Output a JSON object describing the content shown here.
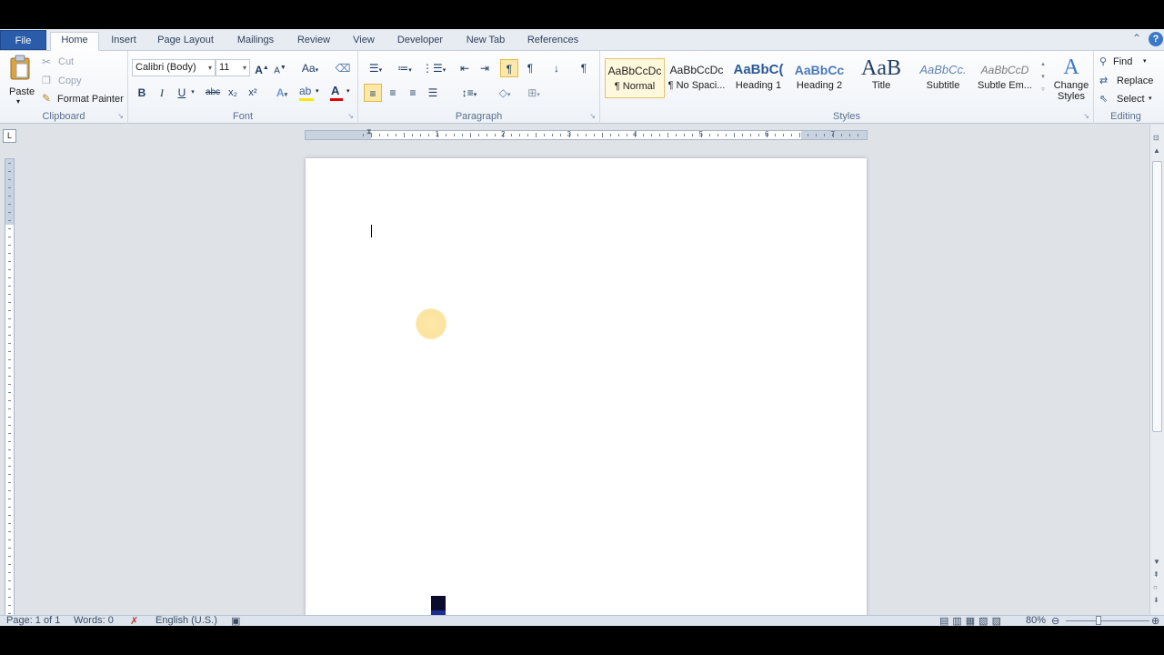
{
  "tabs": {
    "file": "File",
    "home": "Home",
    "insert": "Insert",
    "page_layout": "Page Layout",
    "mailings": "Mailings",
    "review": "Review",
    "view": "View",
    "developer": "Developer",
    "new_tab": "New Tab",
    "references": "References"
  },
  "clipboard": {
    "label": "Clipboard",
    "paste": "Paste",
    "cut": "Cut",
    "copy": "Copy",
    "format_painter": "Format Painter"
  },
  "font": {
    "label": "Font",
    "family": "Calibri (Body)",
    "size": "11",
    "bold": "B",
    "italic": "I",
    "underline": "U",
    "strike": "abc",
    "subscript": "x₂",
    "superscript": "x²"
  },
  "paragraph": {
    "label": "Paragraph"
  },
  "styles": {
    "label": "Styles",
    "items": [
      {
        "preview": "AaBbCcDc",
        "name": "¶ Normal"
      },
      {
        "preview": "AaBbCcDc",
        "name": "¶ No Spaci..."
      },
      {
        "preview": "AaBbC(",
        "name": "Heading 1"
      },
      {
        "preview": "AaBbCc",
        "name": "Heading 2"
      },
      {
        "preview": "AaB",
        "name": "Title"
      },
      {
        "preview": "AaBbCc.",
        "name": "Subtitle"
      },
      {
        "preview": "AaBbCcD",
        "name": "Subtle Em..."
      }
    ],
    "change_styles": "Change Styles"
  },
  "editing": {
    "label": "Editing",
    "find": "Find",
    "replace": "Replace",
    "select": "Select"
  },
  "ruler_numbers": [
    "1",
    "2",
    "3",
    "4",
    "5",
    "6",
    "7"
  ],
  "status": {
    "page": "Page: 1 of 1",
    "words": "Words: 0",
    "language": "English (U.S.)",
    "zoom": "80%"
  },
  "colors": {
    "file_tab": "#2a5caa",
    "ribbon_bg": "#fdfdfe",
    "workspace_bg": "#dfe3e8",
    "font_color_bar": "#e00000",
    "highlight_bar": "#ffe800"
  }
}
